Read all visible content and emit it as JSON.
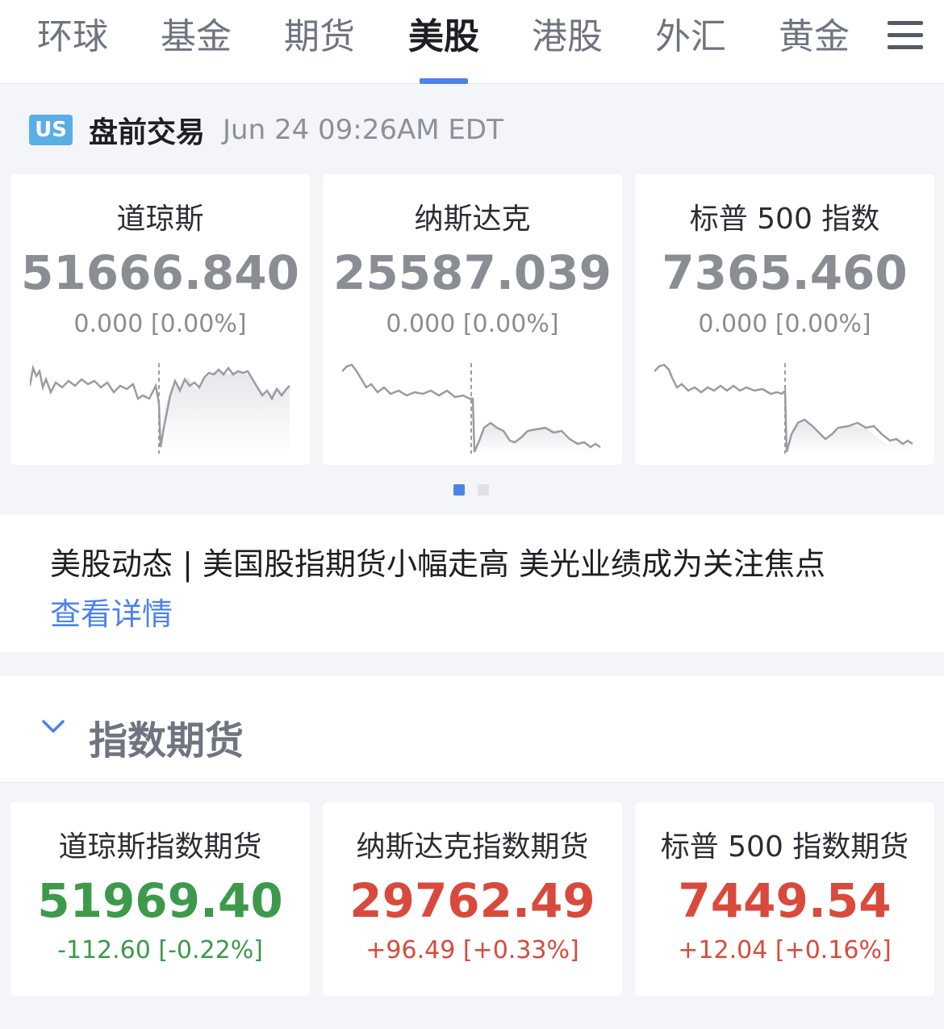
{
  "tabs": [
    {
      "label": "环球"
    },
    {
      "label": "基金"
    },
    {
      "label": "期货"
    },
    {
      "label": "美股"
    },
    {
      "label": "港股"
    },
    {
      "label": "外汇"
    },
    {
      "label": "黄金"
    }
  ],
  "active_tab": "美股",
  "market": {
    "badge": "US",
    "title": "盘前交易",
    "time": "Jun 24 09:26AM EDT"
  },
  "indices": [
    {
      "name": "道琼斯",
      "value": "51666.840",
      "change": "0.000 [0.00%]"
    },
    {
      "name": "纳斯达克",
      "value": "25587.039",
      "change": "0.000 [0.00%]"
    },
    {
      "name": "标普 500 指数",
      "value": "7365.460",
      "change": "0.000 [0.00%]"
    }
  ],
  "carousel": {
    "pages": 2,
    "current": 1
  },
  "news": {
    "text": "美股动态 | 美国股指期货小幅走高 美光业绩成为关注焦点",
    "link": "查看详情"
  },
  "futures_section": {
    "title": "指数期货"
  },
  "futures": [
    {
      "name": "道琼斯指数期货",
      "value": "51969.40",
      "change": "-112.60 [-0.22%]",
      "direction": "down"
    },
    {
      "name": "纳斯达克指数期货",
      "value": "29762.49",
      "change": "+96.49 [+0.33%]",
      "direction": "up"
    },
    {
      "name": "标普 500 指数期货",
      "value": "7449.54",
      "change": "+12.04 [+0.16%]",
      "direction": "up"
    }
  ],
  "colors": {
    "accent": "#4d82e8",
    "up": "#d94a3c",
    "down": "#3c9a4a",
    "neutral": "#8a8d93"
  }
}
